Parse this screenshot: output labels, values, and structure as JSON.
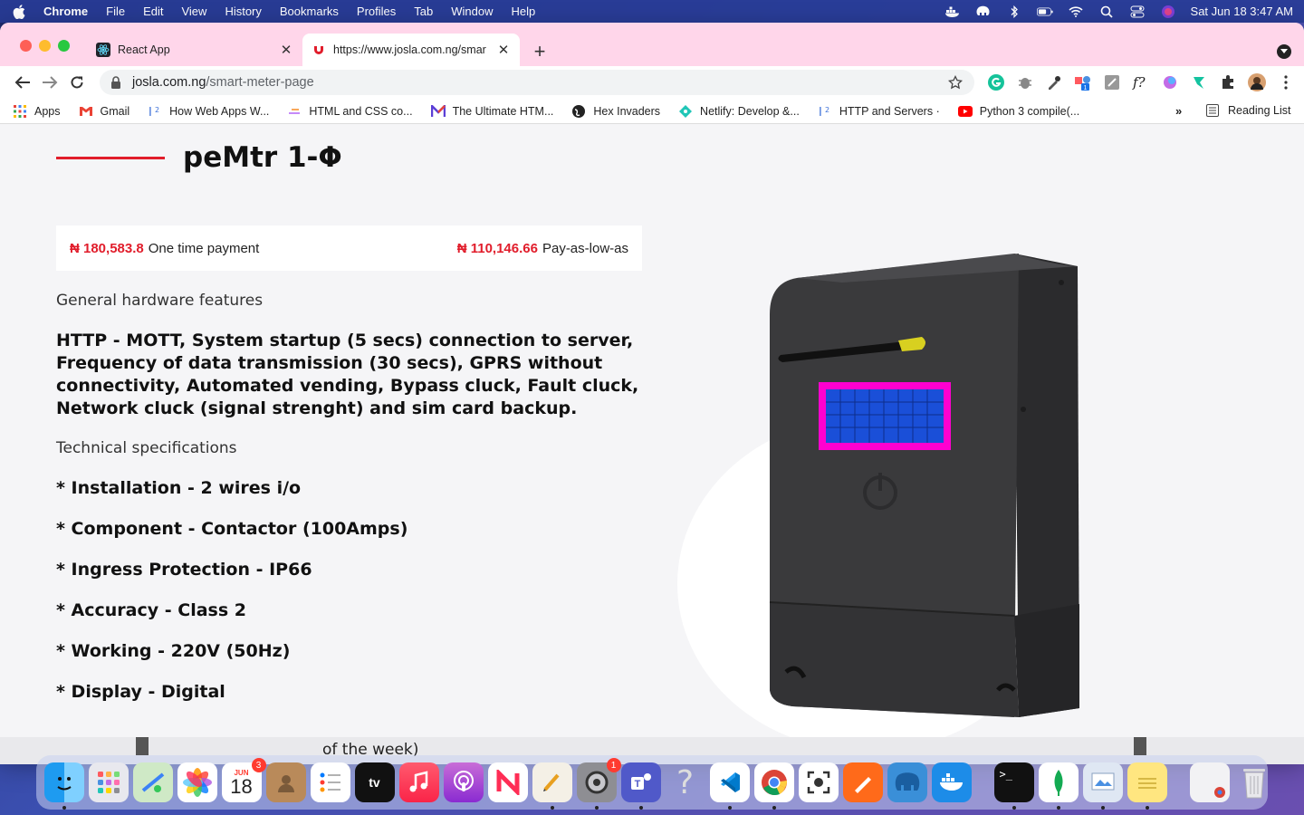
{
  "menubar": {
    "app_name": "Chrome",
    "items": [
      "File",
      "Edit",
      "View",
      "History",
      "Bookmarks",
      "Profiles",
      "Tab",
      "Window",
      "Help"
    ],
    "clock": "Sat Jun 18  3:47 AM"
  },
  "tabs": [
    {
      "title": "React App",
      "active": false
    },
    {
      "title": "https://www.josla.com.ng/smar",
      "active": true
    }
  ],
  "omnibox": {
    "domain": "josla.com.ng",
    "path": "/smart-meter-page"
  },
  "bookmarks": [
    {
      "label": "Apps",
      "icon": "apps-grid-icon"
    },
    {
      "label": "Gmail",
      "icon": "gmail-icon"
    },
    {
      "label": "How Web Apps W...",
      "icon": "i2-icon"
    },
    {
      "label": "HTML and CSS co...",
      "icon": "css-icon"
    },
    {
      "label": "The Ultimate HTM...",
      "icon": "m-logo-icon"
    },
    {
      "label": "Hex Invaders",
      "icon": "globe-icon"
    },
    {
      "label": "Netlify: Develop &...",
      "icon": "netlify-icon"
    },
    {
      "label": "HTTP and Servers ·",
      "icon": "i2-icon"
    },
    {
      "label": "Python 3 compile(...",
      "icon": "youtube-icon"
    }
  ],
  "reading_list": "Reading List",
  "product": {
    "title": "peMtr 1-Φ",
    "price_one_time": "₦ 180,583.8",
    "price_one_time_label": "One time payment",
    "price_low": "₦ 110,146.66",
    "price_low_label": "Pay-as-low-as",
    "features_heading": "General hardware features",
    "features_text": "HTTP - MOTT, System startup (5 secs) connection to server, Frequency of data transmission (30 secs), GPRS without connectivity, Automated vending, Bypass cluck, Fault cluck, Network cluck (signal strenght) and sim card backup.",
    "specs_heading": "Technical specifications",
    "specs": [
      "* Installation - 2 wires i/o",
      "* Component - Contactor (100Amps)",
      "* Ingress Protection - IP66",
      "* Accuracy - Class 2",
      "* Working - 220V (50Hz)",
      "* Display - Digital"
    ]
  },
  "background_window_text": "of the week)",
  "dock": {
    "calendar_month": "JUN",
    "calendar_day": "18",
    "calendar_badge": "3",
    "settings_badge": "1",
    "tv_label": "tv"
  },
  "colors": {
    "accent_red": "#e11d2b",
    "tabstrip_pink": "#ffd6ea",
    "lcd_magenta": "#ff00d0",
    "lcd_blue": "#1a4fd8"
  }
}
